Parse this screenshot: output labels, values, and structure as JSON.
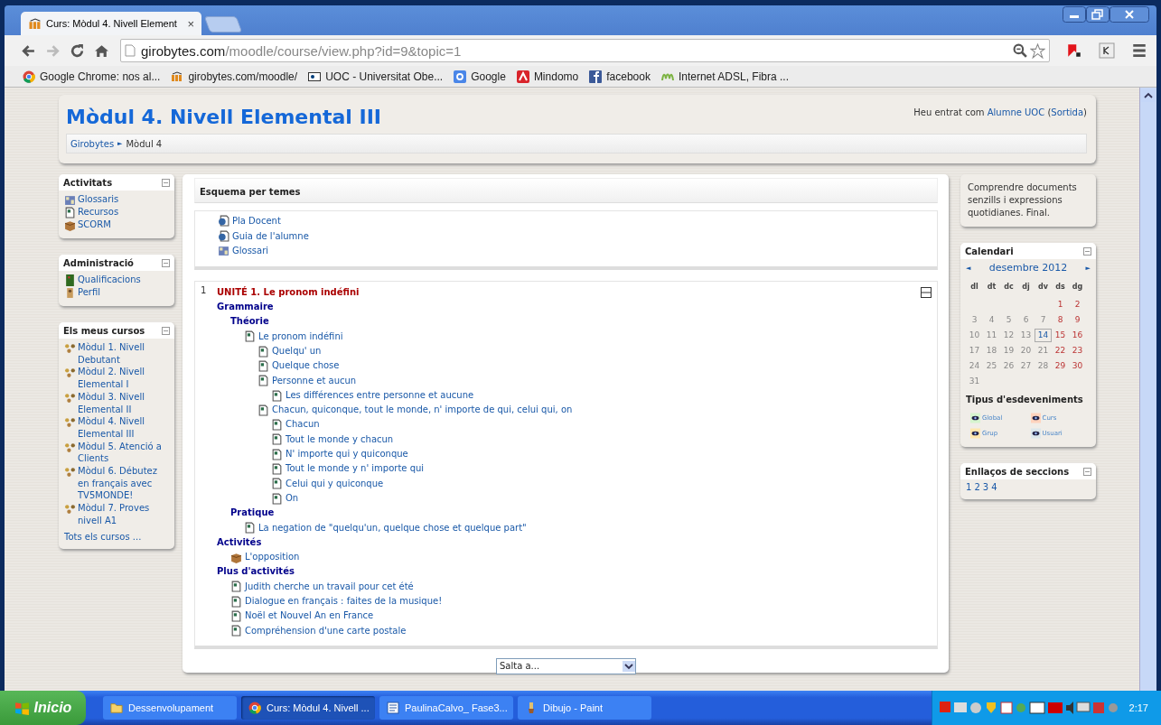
{
  "browser": {
    "tab": {
      "title": "Curs: Mòdul 4. Nivell Element",
      "close": "×"
    },
    "address": {
      "host": "girobytes.com",
      "path": "/moodle/course/view.php?id=9&topic=1"
    },
    "bookmarks": [
      {
        "label": "Google Chrome: nos al...",
        "kind": "chrome"
      },
      {
        "label": "girobytes.com/moodle/",
        "kind": "moodle"
      },
      {
        "label": "UOC - Universitat Obe...",
        "kind": "uoc"
      },
      {
        "label": "Google",
        "kind": "google"
      },
      {
        "label": "Mindomo",
        "kind": "mindomo"
      },
      {
        "label": "facebook",
        "kind": "facebook"
      },
      {
        "label": "Internet ADSL, Fibra ...",
        "kind": "movistar"
      }
    ]
  },
  "header": {
    "title": "Mòdul 4. Nivell Elemental III",
    "login": {
      "prefix": "Heu entrat com",
      "user": "Alumne UOC",
      "open": "(",
      "logout": "Sortida",
      "close": ")"
    },
    "breadcrumb": {
      "items": [
        "Girobytes",
        "Mòdul 4"
      ],
      "separator": "►"
    }
  },
  "left_blocks": [
    {
      "title": "Activitats",
      "items": [
        {
          "label": "Glossaris",
          "kind": "glossary"
        },
        {
          "label": "Recursos",
          "kind": "resource"
        },
        {
          "label": "SCORM",
          "kind": "scorm"
        }
      ]
    },
    {
      "title": "Administració",
      "items": [
        {
          "label": "Qualificacions",
          "kind": "grades"
        },
        {
          "label": "Perfil",
          "kind": "profile"
        }
      ]
    },
    {
      "title": "Els meus cursos",
      "items": [
        {
          "label": "Mòdul 1. Nivell Debutant",
          "kind": "course"
        },
        {
          "label": "Mòdul 2. Nivell Elemental I",
          "kind": "course"
        },
        {
          "label": "Mòdul 3. Nivell Elemental II",
          "kind": "course"
        },
        {
          "label": "Mòdul 4. Nivell Elemental III",
          "kind": "course"
        },
        {
          "label": "Mòdul 5. Atenció a Clients",
          "kind": "course"
        },
        {
          "label": "Mòdul 6. Débutez en français avec TV5MONDE!",
          "kind": "course"
        },
        {
          "label": "Mòdul 7. Proves nivell A1",
          "kind": "course"
        }
      ],
      "footer": "Tots els cursos ..."
    }
  ],
  "center": {
    "heading": "Esquema per temes",
    "top_items": [
      {
        "label": "Pla Docent",
        "kind": "globe-doc"
      },
      {
        "label": "Guia de l'alumne",
        "kind": "globe-doc"
      },
      {
        "label": "Glossari",
        "kind": "glossary"
      }
    ],
    "section": {
      "number": "1",
      "title": "UNITÉ 1. Le pronom indéfini",
      "children": [
        {
          "kind": "heading",
          "label": "Grammaire",
          "children": [
            {
              "kind": "heading",
              "label": "Théorie",
              "children": [
                {
                  "kind": "resource",
                  "label": "Le pronom indéfini",
                  "children": [
                    {
                      "kind": "resource",
                      "label": "Quelqu' un"
                    },
                    {
                      "kind": "resource",
                      "label": "Quelque chose"
                    },
                    {
                      "kind": "resource",
                      "label": "Personne et aucun",
                      "children": [
                        {
                          "kind": "resource",
                          "label": "Les différences entre personne et aucune"
                        }
                      ]
                    },
                    {
                      "kind": "resource",
                      "label": "Chacun, quiconque, tout le monde, n' importe de qui, celui qui, on",
                      "children": [
                        {
                          "kind": "resource",
                          "label": "Chacun"
                        },
                        {
                          "kind": "resource",
                          "label": "Tout le monde y chacun"
                        },
                        {
                          "kind": "resource",
                          "label": "N' importe qui y quiconque"
                        },
                        {
                          "kind": "resource",
                          "label": "Tout le monde y n' importe qui"
                        },
                        {
                          "kind": "resource",
                          "label": "Celui qui y quiconque"
                        },
                        {
                          "kind": "resource",
                          "label": "On"
                        }
                      ]
                    }
                  ]
                }
              ]
            },
            {
              "kind": "heading",
              "label": "Pratique",
              "children": [
                {
                  "kind": "resource",
                  "label": "La negation de \"quelqu'un, quelque chose et quelque part\""
                }
              ]
            }
          ]
        },
        {
          "kind": "heading",
          "label": "Activités",
          "children": [
            {
              "kind": "scorm",
              "label": "L'opposition"
            }
          ]
        },
        {
          "kind": "heading",
          "label": "Plus d'activités",
          "children": [
            {
              "kind": "resource",
              "label": "Judith cherche un travail pour cet été"
            },
            {
              "kind": "resource",
              "label": "Dialogue en français : faites de la musique!"
            },
            {
              "kind": "resource",
              "label": "Noël et Nouvel An en France"
            },
            {
              "kind": "resource",
              "label": "Compréhension d'une carte postale"
            }
          ]
        }
      ]
    },
    "jump": {
      "value": "Salta a..."
    }
  },
  "right": {
    "summary": "Comprendre documents senzills i expressions quotidianes. Final.",
    "calendar": {
      "title": "Calendari",
      "prev": "◄",
      "month": "desembre 2012",
      "next": "►",
      "weekdays": [
        "dl",
        "dt",
        "dc",
        "dj",
        "dv",
        "ds",
        "dg"
      ],
      "weeks": [
        [
          {
            "d": "1",
            "today": false
          },
          {
            "d": "2",
            "today": false
          }
        ],
        [
          {
            "d": "3",
            "today": false
          },
          {
            "d": "4",
            "today": false
          },
          {
            "d": "5",
            "today": false
          },
          {
            "d": "6",
            "today": false
          },
          {
            "d": "7",
            "today": false
          },
          {
            "d": "8",
            "today": false
          },
          {
            "d": "9",
            "today": false
          }
        ],
        [
          {
            "d": "10",
            "today": false
          },
          {
            "d": "11",
            "today": false
          },
          {
            "d": "12",
            "today": false
          },
          {
            "d": "13",
            "today": false
          },
          {
            "d": "14",
            "today": true
          },
          {
            "d": "15",
            "today": false
          },
          {
            "d": "16",
            "today": false
          }
        ],
        [
          {
            "d": "17",
            "today": false
          },
          {
            "d": "18",
            "today": false
          },
          {
            "d": "19",
            "today": false
          },
          {
            "d": "20",
            "today": false
          },
          {
            "d": "21",
            "today": false
          },
          {
            "d": "22",
            "today": false
          },
          {
            "d": "23",
            "today": false
          }
        ],
        [
          {
            "d": "24",
            "today": false
          },
          {
            "d": "25",
            "today": false
          },
          {
            "d": "26",
            "today": false
          },
          {
            "d": "27",
            "today": false
          },
          {
            "d": "28",
            "today": false
          },
          {
            "d": "29",
            "today": false
          },
          {
            "d": "30",
            "today": false
          }
        ],
        [
          {
            "d": "31",
            "today": false
          }
        ]
      ],
      "legend_title": "Tipus d'esdeveniments",
      "legend": [
        {
          "label": "Global",
          "color": "#d6f5cf"
        },
        {
          "label": "Curs",
          "color": "#ffd3bd"
        },
        {
          "label": "Grup",
          "color": "#fee7ae"
        },
        {
          "label": "Usuari",
          "color": "#dce7ec"
        }
      ]
    },
    "sections": {
      "title": "Enllaços de seccions",
      "links": [
        "1",
        "2",
        "3",
        "4"
      ]
    }
  },
  "taskbar": {
    "start": "Inicio",
    "tasks": [
      {
        "label": "Dessenvolupament",
        "kind": "folder",
        "selected": false
      },
      {
        "label": "Curs: Mòdul 4. Nivell ...",
        "kind": "browser",
        "selected": true
      },
      {
        "label": "PaulinaCalvo_ Fase3...",
        "kind": "document",
        "selected": false
      },
      {
        "label": "Dibujo - Paint",
        "kind": "paint",
        "selected": false
      }
    ],
    "clock": "2:17"
  }
}
